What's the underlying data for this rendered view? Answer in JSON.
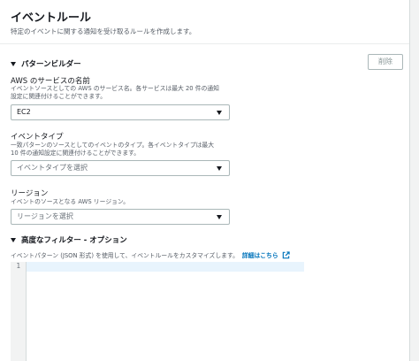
{
  "header": {
    "title": "イベントルール",
    "subtitle": "特定のイベントに関する通知を受け取るルールを作成します。"
  },
  "pattern_builder": {
    "title": "パターンビルダー",
    "delete_label": "削除",
    "service": {
      "label": "AWS のサービスの名前",
      "desc_line1": "イベントソースとしての AWS のサービス名。各サービスは最大 20 件の通知",
      "desc_line2": "設定に関連付けることができます。",
      "value": "EC2"
    },
    "event_type": {
      "label": "イベントタイプ",
      "desc_line1": "一致パターンのソースとしてのイベントのタイプ。各イベントタイプは最大",
      "desc_line2": "10 件の通知設定に関連付けることができます。",
      "placeholder": "イベントタイプを選択"
    },
    "region": {
      "label": "リージョン",
      "desc": "イベントのソースとなる AWS リージョン。",
      "placeholder": "リージョンを選択"
    }
  },
  "advanced_filter": {
    "title": "高度なフィルター - オプション",
    "desc": "イベントパターン (JSON 形式) を使用して、イベントルールをカスタマイズします。",
    "link": "詳細はこちら",
    "editor_line_number": "1"
  }
}
